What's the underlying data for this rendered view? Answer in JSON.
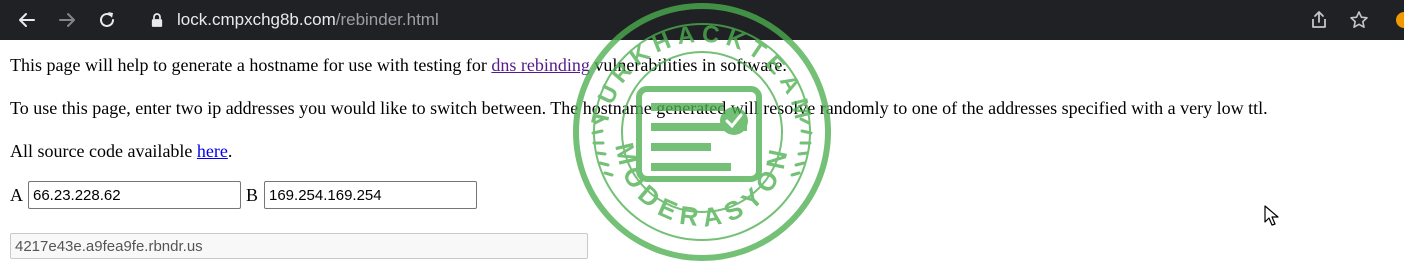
{
  "browser": {
    "url_host": "lock.cmpxchg8b.com",
    "url_path": "/rebinder.html",
    "icons": {
      "back": "back-arrow-icon",
      "forward": "forward-arrow-icon",
      "reload": "reload-icon",
      "lock": "lock-icon",
      "share": "share-icon",
      "bookmark": "star-icon"
    }
  },
  "page": {
    "intro_before": "This page will help to generate a hostname for use with testing for ",
    "intro_link": "dns rebinding",
    "intro_after": " vulnerabilities in software.",
    "instructions": "To use this page, enter two ip addresses you would like to switch between. The hostname generated will resolve randomly to one of the addresses specified with a very low ttl.",
    "source_before": "All source code available ",
    "source_link": "here",
    "source_after": ".",
    "label_a": "A",
    "label_b": "B",
    "ip_a": "66.23.228.62",
    "ip_b": "169.254.169.254",
    "generated_hostname": "4217e43e.a9fea9fe.rbndr.us"
  },
  "watermark": {
    "top_text": "TURKHACKTEAM",
    "bottom_text": "MODERASYON",
    "color": "#4caf50"
  }
}
